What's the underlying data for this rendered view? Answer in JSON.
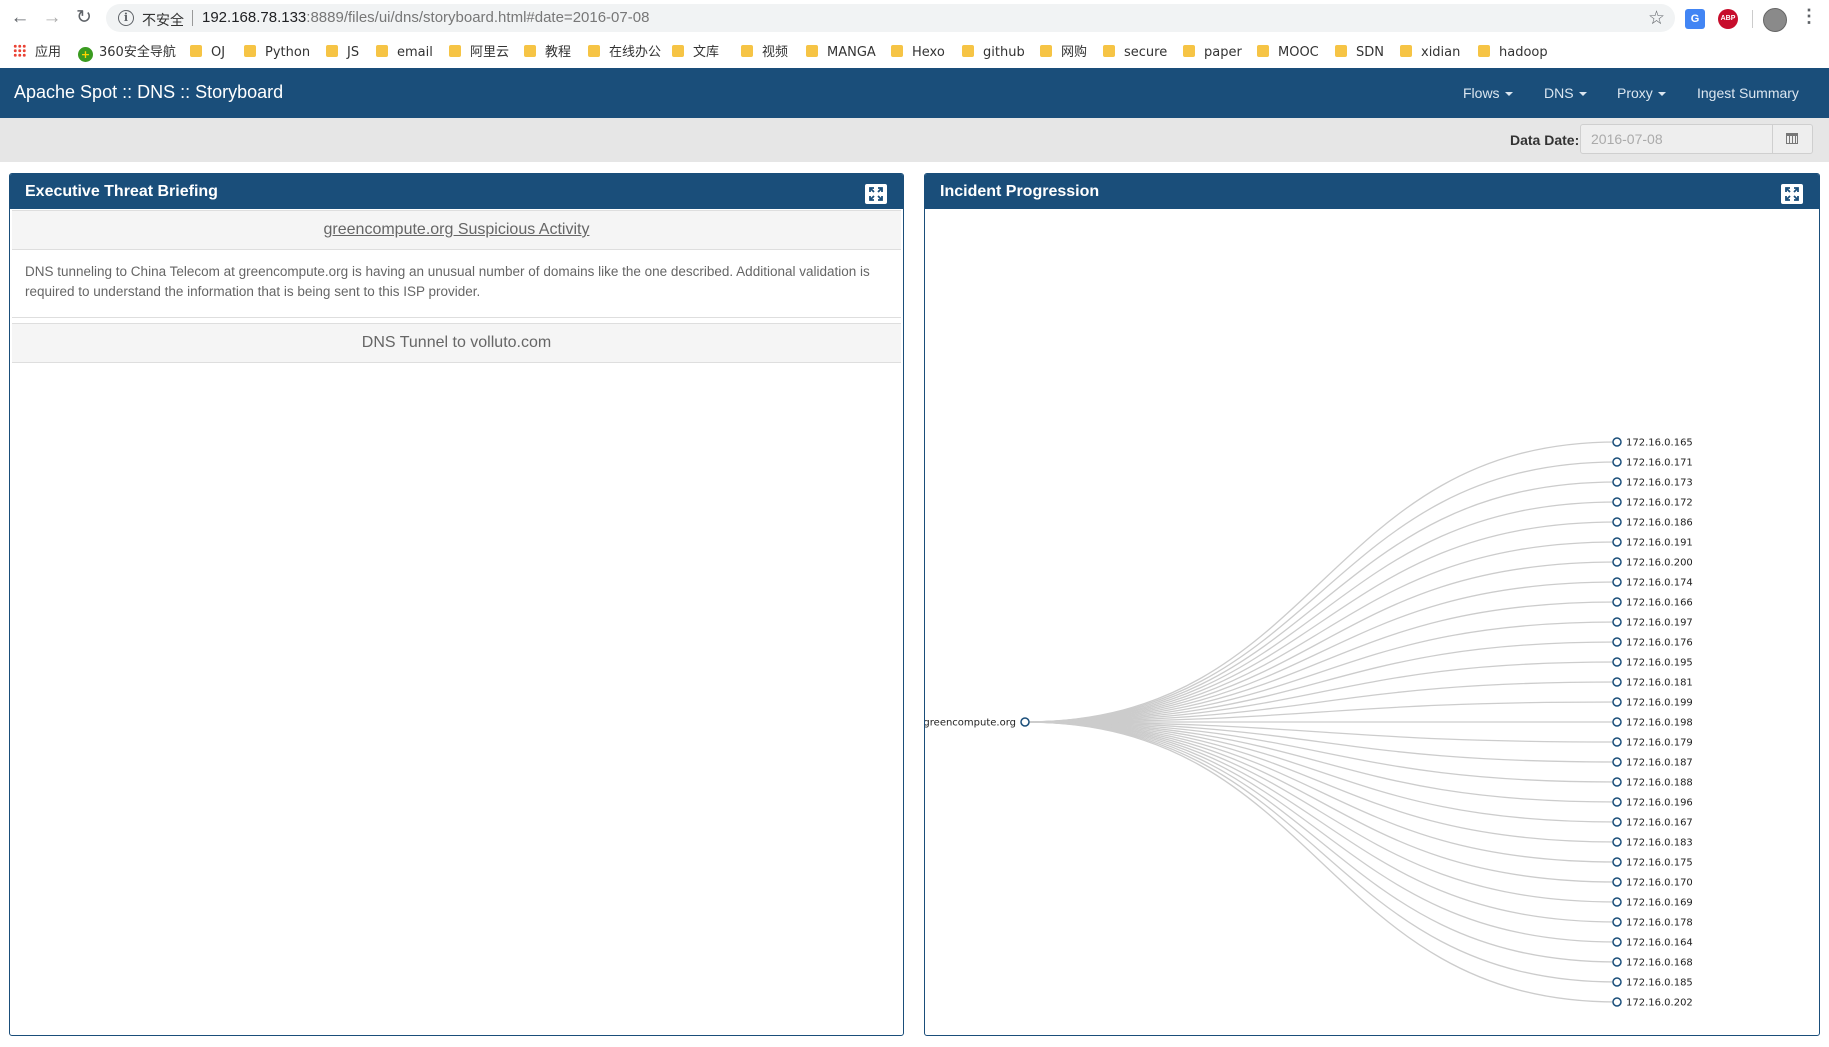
{
  "browser": {
    "security_label": "不安全",
    "url_host": "192.168.78.133",
    "url_rest": ":8889/files/ui/dns/storyboard.html#date=2016-07-08",
    "icons": [
      "back-icon",
      "forward-icon",
      "reload-icon",
      "info-icon",
      "star-icon",
      "translate-icon",
      "adblock-icon",
      "profile-icon",
      "menu-icon"
    ]
  },
  "bookmarks": [
    {
      "label": "应用",
      "icon": "apps-icon"
    },
    {
      "label": "360安全导航",
      "icon": "360-icon"
    },
    {
      "label": "OJ",
      "icon": "folder-icon"
    },
    {
      "label": "Python",
      "icon": "folder-icon"
    },
    {
      "label": "JS",
      "icon": "folder-icon"
    },
    {
      "label": "email",
      "icon": "folder-icon"
    },
    {
      "label": "阿里云",
      "icon": "folder-icon"
    },
    {
      "label": "教程",
      "icon": "folder-icon"
    },
    {
      "label": "在线办公",
      "icon": "folder-icon"
    },
    {
      "label": "文库",
      "icon": "folder-icon"
    },
    {
      "label": "视频",
      "icon": "folder-icon"
    },
    {
      "label": "MANGA",
      "icon": "folder-icon"
    },
    {
      "label": "Hexo",
      "icon": "folder-icon"
    },
    {
      "label": "github",
      "icon": "folder-icon"
    },
    {
      "label": "网购",
      "icon": "folder-icon"
    },
    {
      "label": "secure",
      "icon": "folder-icon"
    },
    {
      "label": "paper",
      "icon": "folder-icon"
    },
    {
      "label": "MOOC",
      "icon": "folder-icon"
    },
    {
      "label": "SDN",
      "icon": "folder-icon"
    },
    {
      "label": "xidian",
      "icon": "folder-icon"
    },
    {
      "label": "hadoop",
      "icon": "folder-icon"
    }
  ],
  "navbar": {
    "brand": "Apache Spot :: DNS :: Storyboard",
    "items": [
      {
        "label": "Flows",
        "dropdown": true
      },
      {
        "label": "DNS",
        "dropdown": true
      },
      {
        "label": "Proxy",
        "dropdown": true
      },
      {
        "label": "Ingest Summary",
        "dropdown": false
      }
    ],
    "bg_color": "#1a4e7a"
  },
  "date_bar": {
    "label": "Data Date:",
    "value": "2016-07-08"
  },
  "executive_briefing": {
    "title": "Executive Threat Briefing",
    "stories": [
      {
        "title": "greencompute.org Suspicious Activity",
        "body": "DNS tunneling to China Telecom at greencompute.org is having an unusual number of domains like the one described. Additional validation is required to understand the information that is being sent to this ISP provider."
      },
      {
        "title": "DNS Tunnel to volluto.com"
      }
    ]
  },
  "incident_progression": {
    "title": "Incident Progression",
    "root": "greencompute.org",
    "children": [
      "172.16.0.165",
      "172.16.0.171",
      "172.16.0.173",
      "172.16.0.172",
      "172.16.0.186",
      "172.16.0.191",
      "172.16.0.200",
      "172.16.0.174",
      "172.16.0.166",
      "172.16.0.197",
      "172.16.0.176",
      "172.16.0.195",
      "172.16.0.181",
      "172.16.0.199",
      "172.16.0.198",
      "172.16.0.179",
      "172.16.0.187",
      "172.16.0.188",
      "172.16.0.196",
      "172.16.0.167",
      "172.16.0.183",
      "172.16.0.175",
      "172.16.0.170",
      "172.16.0.169",
      "172.16.0.178",
      "172.16.0.164",
      "172.16.0.168",
      "172.16.0.185",
      "172.16.0.202"
    ],
    "node_color": "#1a4e7a",
    "link_color": "#cccccc"
  }
}
